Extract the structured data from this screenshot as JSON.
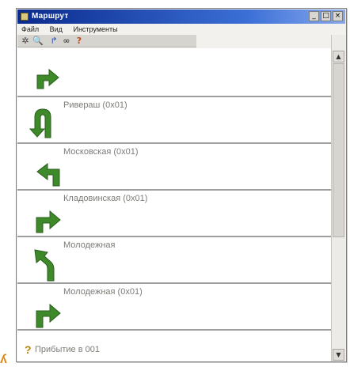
{
  "window": {
    "title": "Маршрут",
    "minimize_glyph": "_",
    "maximize_glyph": "□",
    "close_glyph": "×"
  },
  "menu": {
    "items": [
      "Файл",
      "Вид",
      "Инструменты"
    ]
  },
  "toolbar": {
    "tools": [
      {
        "icon": "pin-icon",
        "glyph": "✲"
      },
      {
        "icon": "zoom-icon",
        "glyph": "🔍"
      },
      {
        "icon": "turn-arrow-icon",
        "glyph": "↱"
      },
      {
        "icon": "link-icon",
        "glyph": "∞"
      },
      {
        "icon": "help-icon",
        "glyph": "?"
      }
    ]
  },
  "route": {
    "steps": [
      {
        "icon": "turn-right-arrow-icon",
        "label": ""
      },
      {
        "icon": "u-turn-arrow-icon",
        "label": "Ривераш (0x01)"
      },
      {
        "icon": "turn-left-arrow-icon",
        "label": "Московская (0x01)"
      },
      {
        "icon": "turn-right-arrow-icon",
        "label": "Кладовинская (0x01)"
      },
      {
        "icon": "bear-left-arrow-icon",
        "label": "Молодежная"
      },
      {
        "icon": "turn-right-arrow-icon",
        "label": "Молодежная (0x01)"
      }
    ],
    "footer": {
      "icon": "flag-icon",
      "label": "Прибытие в 001"
    }
  },
  "colors": {
    "arrow_green": "#3e8a2a",
    "titlebar_blue": "#0a2a8c"
  }
}
